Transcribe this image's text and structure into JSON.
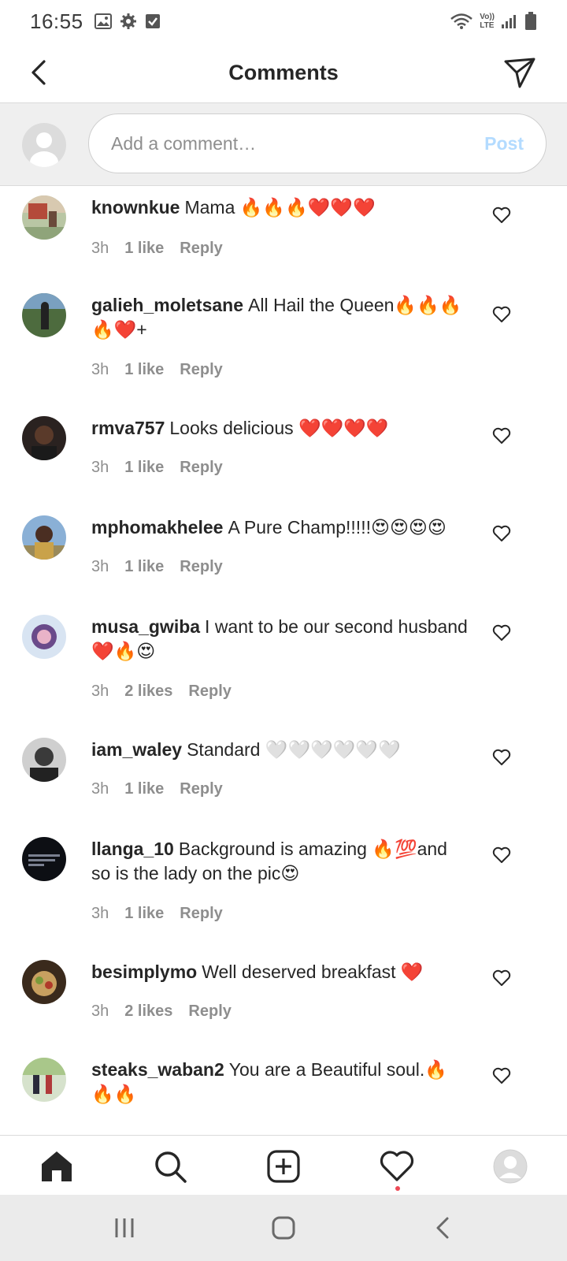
{
  "status_bar": {
    "time": "16:55",
    "left_icons": [
      "image-icon",
      "gear-icon",
      "checkbox-icon"
    ],
    "network_label_top": "Vo))",
    "network_label_bottom": "LTE"
  },
  "header": {
    "title": "Comments",
    "back_icon": "back-chevron-icon",
    "send_icon": "send-icon"
  },
  "compose": {
    "placeholder": "Add a comment…",
    "post_label": "Post",
    "post_color": "#b3dbff"
  },
  "comments": [
    {
      "user": "knownkue",
      "text": "Mama 🔥🔥🔥❤️❤️❤️",
      "time": "3h",
      "likes": "1 like",
      "reply": "Reply"
    },
    {
      "user": "galieh_moletsane",
      "text": "All Hail the Queen🔥🔥🔥🔥❤️+",
      "time": "3h",
      "likes": "1 like",
      "reply": "Reply"
    },
    {
      "user": "rmva757",
      "text": "Looks delicious ❤️❤️❤️❤️",
      "time": "3h",
      "likes": "1 like",
      "reply": "Reply"
    },
    {
      "user": "mphomakhelee",
      "text": "A Pure Champ!!!!!😍😍😍😍",
      "time": "3h",
      "likes": "1 like",
      "reply": "Reply"
    },
    {
      "user": "musa_gwiba",
      "text": "I want to be our second husband ❤️🔥😍",
      "time": "3h",
      "likes": "2 likes",
      "reply": "Reply"
    },
    {
      "user": "iam_waley",
      "text": "Standard 🤍🤍🤍🤍🤍🤍",
      "time": "3h",
      "likes": "1 like",
      "reply": "Reply"
    },
    {
      "user": "llanga_10",
      "text": "Background is amazing 🔥💯and so is the lady on the pic😍",
      "time": "3h",
      "likes": "1 like",
      "reply": "Reply"
    },
    {
      "user": "besimplymo",
      "text": "Well deserved breakfast ❤️",
      "time": "3h",
      "likes": "2 likes",
      "reply": "Reply"
    },
    {
      "user": "steaks_waban2",
      "text": "You are a Beautiful soul.🔥🔥🔥",
      "time": "",
      "likes": "",
      "reply": ""
    }
  ],
  "bottom_nav": {
    "items": [
      "home-icon",
      "search-icon",
      "add-post-icon",
      "activity-heart-icon",
      "profile-avatar-icon"
    ],
    "notification_dot_color": "#ed4956"
  },
  "system_nav": {
    "items": [
      "recents-icon",
      "home-button-icon",
      "back-icon"
    ]
  }
}
